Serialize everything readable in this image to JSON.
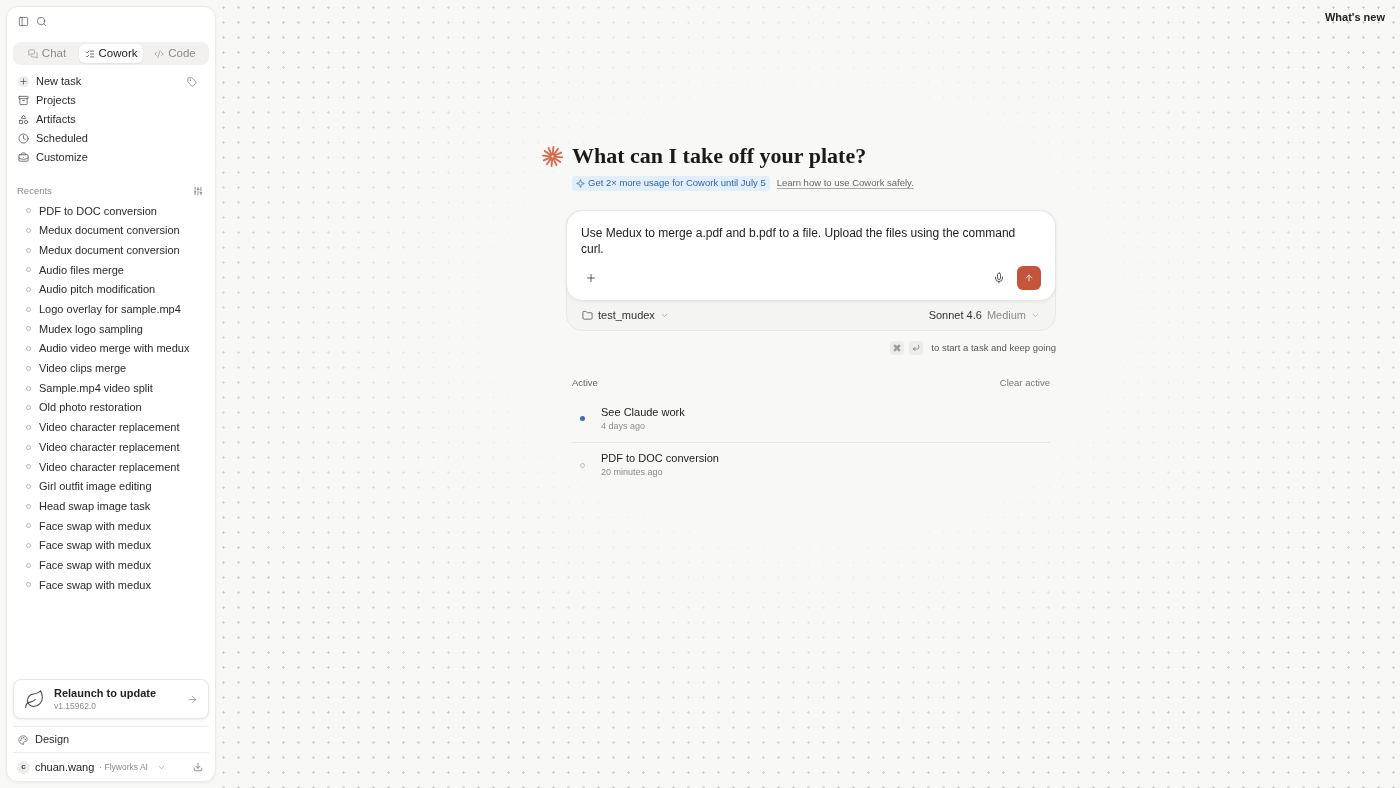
{
  "sidebar": {
    "tabs": [
      {
        "label": "Chat",
        "selected": false
      },
      {
        "label": "Cowork",
        "selected": true
      },
      {
        "label": "Code",
        "selected": false
      }
    ],
    "nav": [
      {
        "label": "New task"
      },
      {
        "label": "Projects"
      },
      {
        "label": "Artifacts"
      },
      {
        "label": "Scheduled"
      },
      {
        "label": "Customize"
      }
    ],
    "recents": {
      "title": "Recents",
      "items": [
        "PDF to DOC conversion",
        "Medux document conversion",
        "Medux document conversion",
        "Audio files merge",
        "Audio pitch modification",
        "Logo overlay for sample.mp4",
        "Mudex logo sampling",
        "Audio video merge with medux",
        "Video clips merge",
        "Sample.mp4 video split",
        "Old photo restoration",
        "Video character replacement",
        "Video character replacement",
        "Video character replacement",
        "Girl outfit image editing",
        "Head swap image task",
        "Face swap with medux",
        "Face swap with medux",
        "Face swap with medux",
        "Face swap with medux"
      ]
    },
    "update_card": {
      "title": "Relaunch to update",
      "version": "v1.15962.0"
    },
    "design": {
      "label": "Design"
    },
    "user": {
      "initial": "c",
      "name": "chuan.wang",
      "org": "· Flyworks AI"
    }
  },
  "header": {
    "whats_new": "What's new"
  },
  "hero": {
    "title": "What can I take off your plate?",
    "promo": "Get 2× more usage for Cowork until July 5",
    "link": "Learn how to use Cowork safely."
  },
  "composer": {
    "value": "Use Medux to merge a.pdf and b.pdf to a file. Upload the files using the command curl.",
    "folder": "test_mudex",
    "model": "Sonnet 4.6",
    "effort": "Medium",
    "hint": "to start a task and keep going"
  },
  "active": {
    "title": "Active",
    "clear": "Clear active",
    "tasks": [
      {
        "title": "See Claude work",
        "time": "4 days ago",
        "running": true
      },
      {
        "title": "PDF to DOC conversion",
        "time": "20 minutes ago",
        "running": false
      }
    ]
  }
}
